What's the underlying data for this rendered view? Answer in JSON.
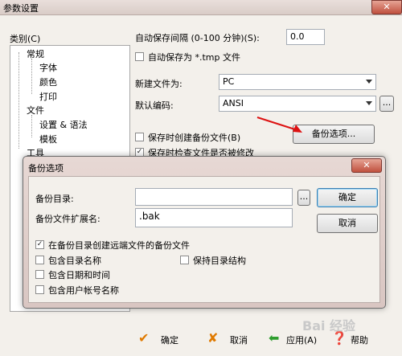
{
  "window": {
    "title": "参数设置",
    "close_label": "✕"
  },
  "category": {
    "label": "类别(C)",
    "tree": [
      "常规",
      "字体",
      "颜色",
      "打印",
      "文件",
      "设置 & 语法",
      "模板",
      "工具"
    ]
  },
  "settings": {
    "autosave_interval_label": "自动保存间隔 (0-100 分钟)(S):",
    "autosave_interval_value": "0.0",
    "autosave_tmp_label": "自动保存为 *.tmp 文件",
    "new_file_label": "新建文件为:",
    "new_file_value": "PC",
    "default_encoding_label": "默认编码:",
    "default_encoding_value": "ANSI",
    "ellipsis": "...",
    "backup_on_save_label": "保存时创建备份文件(B)",
    "backup_options_button": "备份选项...",
    "check_modified_label": "保存时检查文件是否被修改"
  },
  "dialog": {
    "title": "备份选项",
    "close_label": "✕",
    "backup_dir_label": "备份目录:",
    "backup_dir_value": "",
    "ellipsis": "...",
    "ext_label": "备份文件扩展名:",
    "ext_value": ".bak",
    "ok_button": "确定",
    "cancel_button": "取消",
    "options": [
      {
        "label": "在备份目录创建远端文件的备份文件",
        "checked": true
      },
      {
        "label": "包含目录名称",
        "checked": false
      },
      {
        "label": "保持目录结构",
        "checked": false
      },
      {
        "label": "包含日期和时间",
        "checked": false
      },
      {
        "label": "包含用户帐号名称",
        "checked": false
      }
    ]
  },
  "bottom_bar": {
    "ok": "确定",
    "cancel": "取消",
    "apply": "应用(A)",
    "help": "帮助"
  },
  "watermark": "Bai 经验"
}
